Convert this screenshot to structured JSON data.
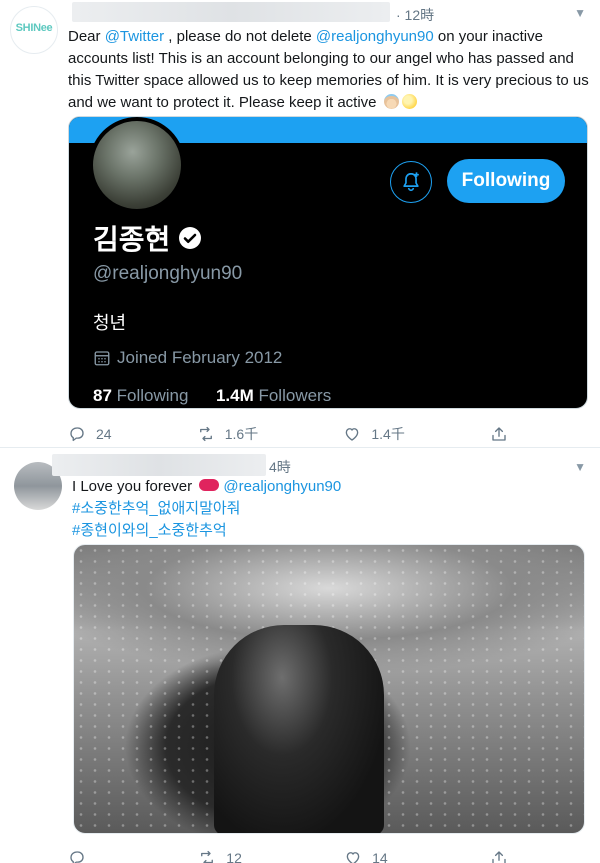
{
  "tweet1": {
    "avatar_logo": "SHINee",
    "time": "· 12時",
    "text_before_mention1": "Dear ",
    "mention1": "@Twitter",
    "text_mid": " , please do not delete ",
    "mention2": "@realjonghyun90",
    "text_after": " on your inactive accounts list! This is an account belonging to our angel who has passed and this Twitter space allowed us to keep memories of him. It is very precious to us and we want to protect it. Please keep it active",
    "emojis": [
      "angel-emoji",
      "moon-emoji"
    ],
    "card": {
      "name": "김종현",
      "handle": "@realjonghyun90",
      "bio": "청년",
      "joined": "Joined February 2012",
      "following_count": "87",
      "following_label": "Following",
      "followers_count": "1.4M",
      "followers_label": "Followers",
      "follow_button": "Following",
      "accent_color": "#1da1f2"
    },
    "actions": {
      "reply": "24",
      "retweet": "1.6千",
      "like": "1.4千"
    }
  },
  "tweet2": {
    "time": "4時",
    "line1_text": "I Love you forever ",
    "line1_mention": "@realjonghyun90",
    "hashtag1": "#소중한추억_없애지말아줘",
    "hashtag2": "#종현이와의_소중한추억",
    "actions": {
      "reply": "",
      "retweet": "12",
      "like": "14"
    }
  }
}
